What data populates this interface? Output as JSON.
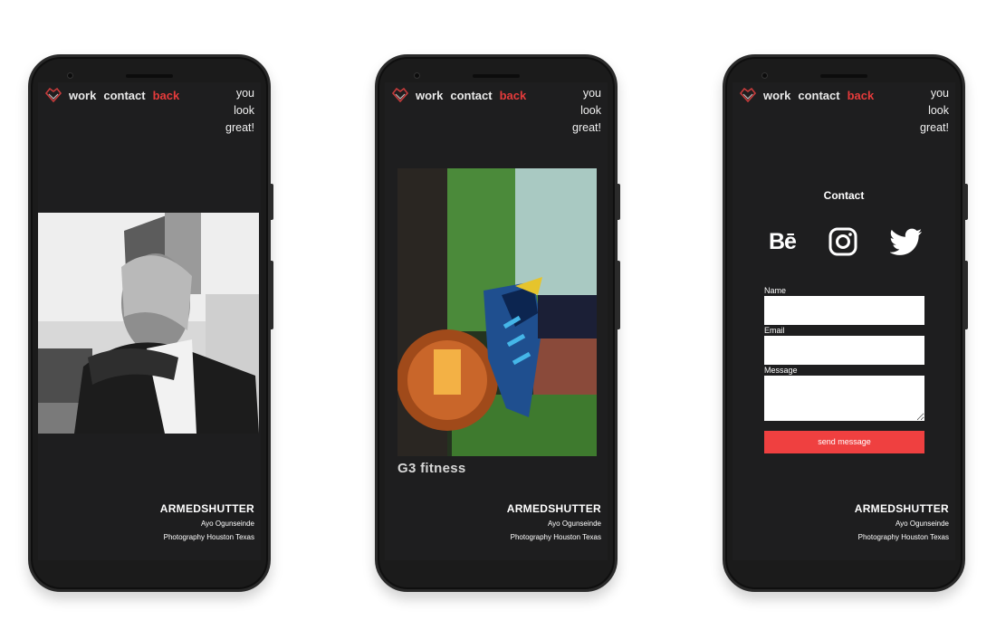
{
  "nav": {
    "work": "work",
    "contact": "contact",
    "back": "back"
  },
  "greeting": {
    "line1": "you",
    "line2": "look",
    "line3": "great!"
  },
  "footer": {
    "brand": "ARMEDSHUTTER",
    "name": "Ayo Ogunseinde",
    "tagline": "Photography Houston Texas"
  },
  "phone2": {
    "caption": "G3 fitness"
  },
  "contact": {
    "title": "Contact",
    "social": {
      "behance": "Bē"
    },
    "name_label": "Name",
    "email_label": "Email",
    "message_label": "Message",
    "send_label": "send message"
  },
  "colors": {
    "accent": "#ef4040",
    "background": "#1e1e1f",
    "nav_back": "#e53b3b"
  },
  "icons": [
    "logo-icon",
    "behance-icon",
    "instagram-icon",
    "twitter-icon"
  ]
}
